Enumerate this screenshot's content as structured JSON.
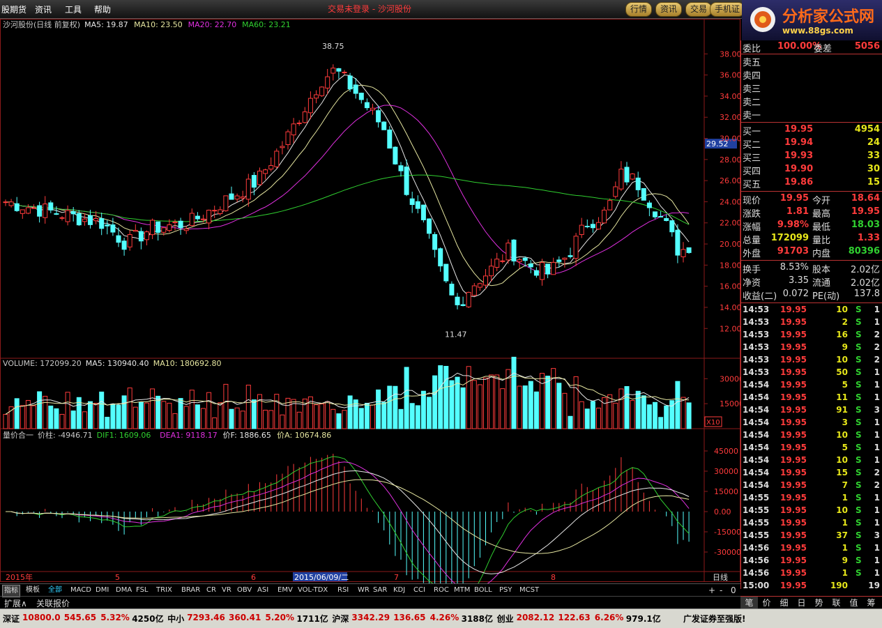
{
  "menu": {
    "items": [
      "股期货",
      "资讯",
      "工具",
      "帮助"
    ],
    "title": "交易未登录 - 沙河股份"
  },
  "top_buttons": [
    "行情",
    "资讯",
    "交易",
    "手机证"
  ],
  "logo": {
    "main": "分析家公式网",
    "sub": "www.88gs.com"
  },
  "kline": {
    "header": [
      {
        "text": "沙河股份(日线 前复权)",
        "color": "#c8c8c8"
      },
      {
        "text": "MA5: 19.87",
        "color": "#e6e6e6"
      },
      {
        "text": "MA10: 23.50",
        "color": "#e6e6a0"
      },
      {
        "text": "MA20: 22.70",
        "color": "#e030e0"
      },
      {
        "text": "MA60: 23.21",
        "color": "#30d030"
      }
    ],
    "high_marker": "38.75",
    "low_marker": "11.47",
    "crosshair_value": "29.52",
    "y_ticks": [
      "38.00",
      "36.00",
      "34.00",
      "32.00",
      "30.00",
      "28.00",
      "26.00",
      "24.00",
      "22.00",
      "20.00",
      "18.00",
      "16.00",
      "14.00",
      "12.00"
    ]
  },
  "volume": {
    "header": [
      {
        "text": "VOLUME: 172099.20",
        "color": "#c8c8c8"
      },
      {
        "text": "MA5: 130940.40",
        "color": "#e6e6e6"
      },
      {
        "text": "MA10: 180692.80",
        "color": "#e6e6a0"
      }
    ],
    "y_ticks": [
      "30000",
      "15000"
    ],
    "unit": "X10"
  },
  "indicator": {
    "header": [
      {
        "text": "量价合一",
        "color": "#c8c8c8"
      },
      {
        "text": "价柱: -4946.71",
        "color": "#c8c8c8"
      },
      {
        "text": "DIF1: 1609.06",
        "color": "#30d030"
      },
      {
        "text": "DEA1: 9118.17",
        "color": "#e030e0"
      },
      {
        "text": "价F: 1886.65",
        "color": "#e6e6e6"
      },
      {
        "text": "价A: 10674.86",
        "color": "#e6e6a0"
      }
    ],
    "y_ticks": [
      "45000",
      "30000",
      "15000",
      "0.00",
      "-15000",
      "-30000"
    ]
  },
  "time_axis": {
    "labels": [
      "2015年",
      "5",
      "6",
      "7",
      "8"
    ],
    "highlight": "2015/06/09/二",
    "period": "日线"
  },
  "quote": {
    "weibi_label": "委比",
    "weibi": "100.00%",
    "weicha_label": "委差",
    "weicha": "5056",
    "sell": [
      {
        "label": "卖五"
      },
      {
        "label": "卖四"
      },
      {
        "label": "卖三"
      },
      {
        "label": "卖二"
      },
      {
        "label": "卖一"
      }
    ],
    "buy": [
      {
        "label": "买一",
        "price": "19.95",
        "vol": "4954"
      },
      {
        "label": "买二",
        "price": "19.94",
        "vol": "24"
      },
      {
        "label": "买三",
        "price": "19.93",
        "vol": "33"
      },
      {
        "label": "买四",
        "price": "19.90",
        "vol": "30"
      },
      {
        "label": "买五",
        "price": "19.86",
        "vol": "15"
      }
    ],
    "stats": [
      {
        "l1": "现价",
        "v1": "19.95",
        "c1": "#ff3b3b",
        "l2": "今开",
        "v2": "18.64",
        "c2": "#ff3b3b"
      },
      {
        "l1": "涨跌",
        "v1": "1.81",
        "c1": "#ff3b3b",
        "l2": "最高",
        "v2": "19.95",
        "c2": "#ff3b3b"
      },
      {
        "l1": "涨幅",
        "v1": "9.98%",
        "c1": "#ff3b3b",
        "l2": "最低",
        "v2": "18.03",
        "c2": "#30d030"
      },
      {
        "l1": "总量",
        "v1": "172099",
        "c1": "#e6e61a",
        "l2": "量比",
        "v2": "1.33",
        "c2": "#ff3b3b"
      },
      {
        "l1": "外盘",
        "v1": "91703",
        "c1": "#ff3b3b",
        "l2": "内盘",
        "v2": "80396",
        "c2": "#30d030"
      }
    ],
    "stats2": [
      {
        "l1": "换手",
        "v1": "8.53%",
        "l2": "股本",
        "v2": "2.02亿"
      },
      {
        "l1": "净资",
        "v1": "3.35",
        "l2": "流通",
        "v2": "2.02亿"
      },
      {
        "l1": "收益(二)",
        "v1": "0.072",
        "l2": "PE(动)",
        "v2": "137.8"
      }
    ],
    "ticks": [
      {
        "t": "14:53",
        "p": "19.95",
        "v": "10",
        "s": "S",
        "n": "1"
      },
      {
        "t": "14:53",
        "p": "19.95",
        "v": "2",
        "s": "S",
        "n": "1"
      },
      {
        "t": "14:53",
        "p": "19.95",
        "v": "16",
        "s": "S",
        "n": "2"
      },
      {
        "t": "14:53",
        "p": "19.95",
        "v": "9",
        "s": "S",
        "n": "2"
      },
      {
        "t": "14:53",
        "p": "19.95",
        "v": "10",
        "s": "S",
        "n": "2"
      },
      {
        "t": "14:53",
        "p": "19.95",
        "v": "50",
        "s": "S",
        "n": "1"
      },
      {
        "t": "14:54",
        "p": "19.95",
        "v": "5",
        "s": "S",
        "n": "1"
      },
      {
        "t": "14:54",
        "p": "19.95",
        "v": "11",
        "s": "S",
        "n": "1"
      },
      {
        "t": "14:54",
        "p": "19.95",
        "v": "91",
        "s": "S",
        "n": "3"
      },
      {
        "t": "14:54",
        "p": "19.95",
        "v": "3",
        "s": "S",
        "n": "1"
      },
      {
        "t": "14:54",
        "p": "19.95",
        "v": "10",
        "s": "S",
        "n": "1"
      },
      {
        "t": "14:54",
        "p": "19.95",
        "v": "5",
        "s": "S",
        "n": "1"
      },
      {
        "t": "14:54",
        "p": "19.95",
        "v": "10",
        "s": "S",
        "n": "1"
      },
      {
        "t": "14:54",
        "p": "19.95",
        "v": "15",
        "s": "S",
        "n": "2"
      },
      {
        "t": "14:54",
        "p": "19.95",
        "v": "7",
        "s": "S",
        "n": "2"
      },
      {
        "t": "14:55",
        "p": "19.95",
        "v": "1",
        "s": "S",
        "n": "1"
      },
      {
        "t": "14:55",
        "p": "19.95",
        "v": "10",
        "s": "S",
        "n": "1"
      },
      {
        "t": "14:55",
        "p": "19.95",
        "v": "1",
        "s": "S",
        "n": "1"
      },
      {
        "t": "14:55",
        "p": "19.95",
        "v": "37",
        "s": "S",
        "n": "3"
      },
      {
        "t": "14:56",
        "p": "19.95",
        "v": "1",
        "s": "S",
        "n": "1"
      },
      {
        "t": "14:56",
        "p": "19.95",
        "v": "9",
        "s": "S",
        "n": "1"
      },
      {
        "t": "14:56",
        "p": "19.95",
        "v": "1",
        "s": "S",
        "n": "1"
      },
      {
        "t": "15:00",
        "p": "19.95",
        "v": "190",
        "s": "",
        "n": "19"
      }
    ]
  },
  "indicator_tabs": [
    "指标",
    "模板",
    "全部",
    "MACD",
    "DMI",
    "DMA",
    "FSL",
    "TRIX",
    "BRAR",
    "CR",
    "VR",
    "OBV",
    "ASI",
    "EMV",
    "VOL-TDX",
    "RSI",
    "WR",
    "SAR",
    "KDJ",
    "CCI",
    "ROC",
    "MTM",
    "BOLL",
    "PSY",
    "MCST"
  ],
  "bottom_tabs": [
    "扩展∧",
    "关联报价"
  ],
  "zoom_controls": [
    "+",
    "-",
    "0"
  ],
  "right_tabs": [
    "笔",
    "价",
    "细",
    "日",
    "势",
    "联",
    "值",
    "筹"
  ],
  "status": [
    {
      "name": "深证",
      "val": "10800.0",
      "chg": "545.65",
      "pct": "5.32%",
      "amt": "4250亿"
    },
    {
      "name": "中小",
      "val": "7293.46",
      "chg": "360.41",
      "pct": "5.20%",
      "amt": "1711亿"
    },
    {
      "name": "沪深",
      "val": "3342.29",
      "chg": "136.65",
      "pct": "4.26%",
      "amt": "3188亿"
    },
    {
      "name": "创业",
      "val": "2082.12",
      "chg": "122.63",
      "pct": "6.26%",
      "amt": "979.1亿"
    }
  ],
  "status_broker": "广发证券至强版!",
  "colors": {
    "up": "#ff3b3b",
    "down": "#54ffff",
    "grid": "#8b1a1a",
    "ma5": "#e6e6e6",
    "ma10": "#e6e6a0",
    "ma20": "#e030e0",
    "ma60": "#30d030"
  }
}
